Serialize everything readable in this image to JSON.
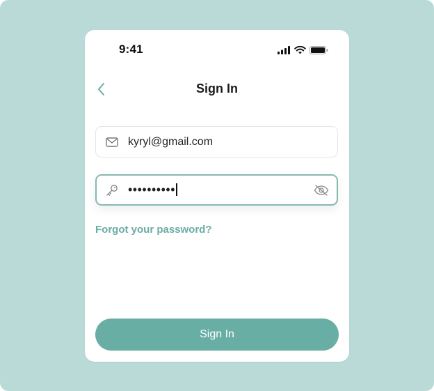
{
  "status_bar": {
    "time": "9:41",
    "icons": [
      "signal-icon",
      "wifi-icon",
      "battery-icon"
    ]
  },
  "header": {
    "back_icon": "chevron-left-icon",
    "title": "Sign In"
  },
  "form": {
    "email": {
      "icon": "mail-icon",
      "value": "kyryl@gmail.com"
    },
    "password": {
      "icon": "key-icon",
      "value": "••••••••••",
      "toggle_icon": "eye-off-icon"
    },
    "forgot_link": "Forgot your password?",
    "submit_label": "Sign In"
  },
  "colors": {
    "backdrop": "#b9dad7",
    "accent": "#68aea5",
    "focus_border": "#87b8b0",
    "link": "#6aada4"
  }
}
